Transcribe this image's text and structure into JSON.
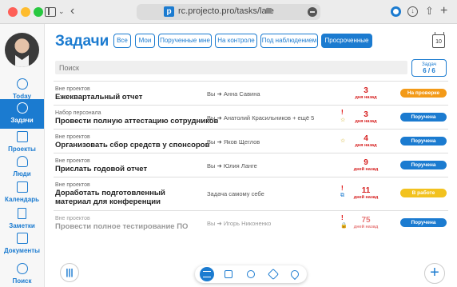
{
  "browser": {
    "url": "rc.projecto.pro/tasks/late",
    "favicon_letter": "p"
  },
  "sidebar": {
    "items": [
      {
        "label": "Today",
        "icon": "compass-icon"
      },
      {
        "label": "Задачи",
        "icon": "check-circle-icon",
        "active": true
      },
      {
        "label": "Проекты",
        "icon": "briefcase-icon"
      },
      {
        "label": "Люди",
        "icon": "person-icon"
      },
      {
        "label": "Календарь",
        "icon": "calendar-icon"
      },
      {
        "label": "Заметки",
        "icon": "notes-icon"
      },
      {
        "label": "Документы",
        "icon": "archive-icon"
      },
      {
        "label": "Поиск",
        "icon": "search-icon"
      }
    ]
  },
  "header": {
    "title": "Задачи",
    "filters": [
      "Все",
      "Мои",
      "Порученные мне",
      "На контроле",
      "Под наблюдением",
      "Просроченные"
    ],
    "active_filter": "Просроченные",
    "calendar_day": "10"
  },
  "search": {
    "placeholder": "Поиск"
  },
  "counter": {
    "label": "Задач",
    "value": "6 / 6"
  },
  "tasks": [
    {
      "project": "Вне проектов",
      "title": "Ежеквартальный отчет",
      "from": "Вы",
      "to": "Анна Савина",
      "days": "3",
      "days_label": "дня назад",
      "status": "На проверке",
      "status_color": "#f39a18"
    },
    {
      "project": "Набор персонала",
      "title": "Провести полную аттестацию сотрудников",
      "from": "Вы",
      "to": "Анатолий Красильников + ещё 5",
      "days": "3",
      "days_label": "дня назад",
      "status": "Поручена",
      "status_color": "#1b7bd0",
      "flag": "!",
      "icon": "☆"
    },
    {
      "project": "Вне проектов",
      "title": "Организовать сбор средств у спонсоров",
      "from": "Вы",
      "to": "Яков Щеглов",
      "days": "4",
      "days_label": "дня назад",
      "status": "Поручена",
      "status_color": "#1b7bd0",
      "icon": "☆"
    },
    {
      "project": "Вне проектов",
      "title": "Прислать годовой отчет",
      "from": "Вы",
      "to": "Юлия Ланге",
      "days": "9",
      "days_label": "дней назад",
      "status": "Поручена",
      "status_color": "#1b7bd0"
    },
    {
      "project": "Вне проектов",
      "title": "Доработать подготовленный материал для конференции",
      "assign_text": "Задача самому себе",
      "days": "11",
      "days_label": "дней назад",
      "status": "В работе",
      "status_color": "#f2c21f",
      "flag": "!",
      "icon": "⧉"
    },
    {
      "project": "Вне проектов",
      "title": "Провести полное тестирование ПО",
      "from": "Вы",
      "to": "Игорь Никоненко",
      "days": "75",
      "days_label": "дней назад",
      "status": "Поручена",
      "status_color": "#1b7bd0",
      "flag": "!",
      "icon": "🔒",
      "faded": true
    }
  ],
  "bottom_bar": {
    "buttons": [
      "list-icon",
      "briefcase-icon",
      "people-icon",
      "tag-icon",
      "location-icon"
    ],
    "active": "list-icon"
  }
}
